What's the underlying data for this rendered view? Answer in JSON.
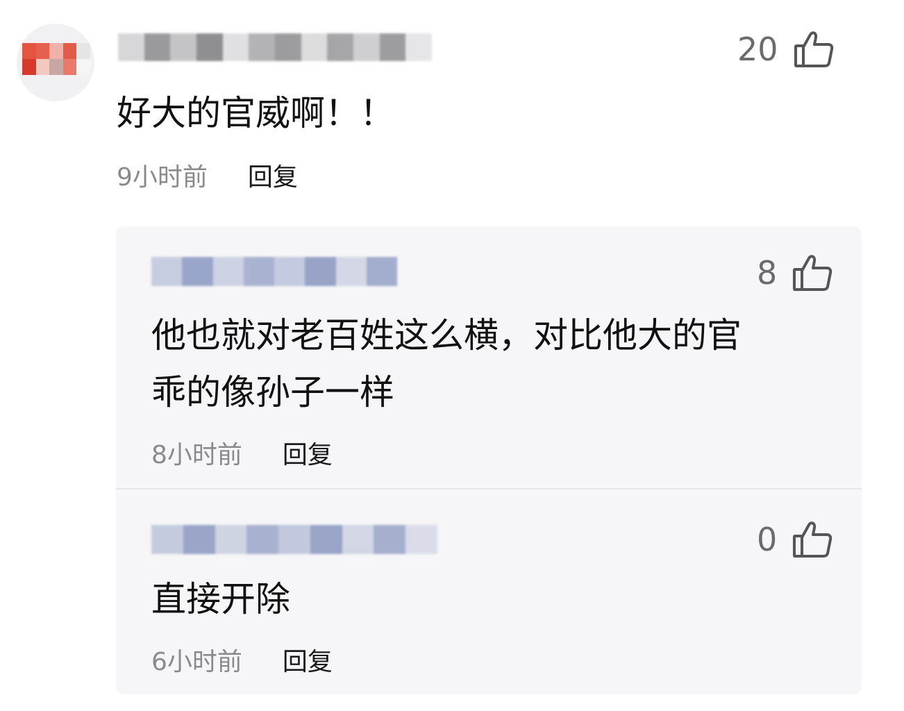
{
  "comment": {
    "likes": "20",
    "text": "好大的官威啊！！",
    "time": "9小时前",
    "reply_label": "回复"
  },
  "replies": [
    {
      "likes": "8",
      "text_line1": "他也就对老百姓这么横，对比他大的官",
      "text_line2": "乖的像孙子一样",
      "time": "8小时前",
      "reply_label": "回复"
    },
    {
      "likes": "0",
      "text_line1": "直接开除",
      "time": "6小时前",
      "reply_label": "回复"
    }
  ],
  "colors": {
    "avatar_red": "#e0463a",
    "username_blur": "#c8ccd8",
    "like_gray": "#6b6b6b",
    "reply_bg": "#f6f6f8"
  },
  "icons": {
    "like": "thumbs-up-icon"
  }
}
